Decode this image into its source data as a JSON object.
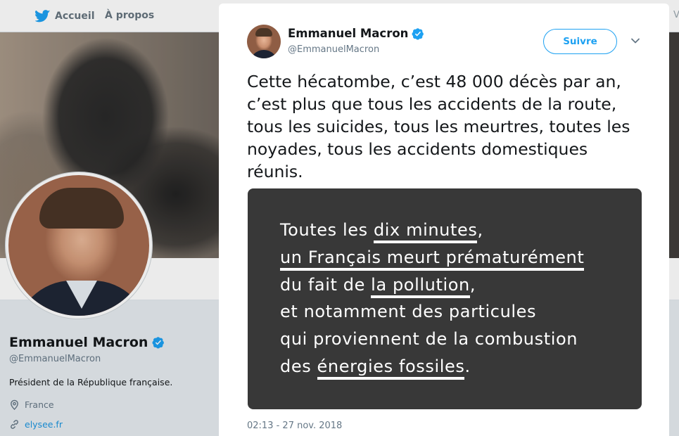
{
  "nav": {
    "home_label": "Accueil",
    "about_label": "À propos",
    "edge_char": "V"
  },
  "profile": {
    "name": "Emmanuel Macron",
    "handle": "@EmmanuelMacron",
    "bio": "Président de la République française.",
    "location": "France",
    "url": "elysee.fr"
  },
  "tweet": {
    "author_name": "Emmanuel Macron",
    "author_handle": "@EmmanuelMacron",
    "follow_label": "Suivre",
    "text": "Cette hécatombe, c’est 48 000 décès par an, c’est plus que tous les accidents de la route, tous les suicides, tous les meurtres, toutes les noyades, tous les accidents domestiques réunis.",
    "timestamp": "02:13 - 27 nov. 2018",
    "image_lines": [
      [
        {
          "t": "Toutes les "
        },
        {
          "t": "dix minutes",
          "u": true
        },
        {
          "t": ","
        }
      ],
      [
        {
          "t": "un Français meurt prématurément",
          "u": true
        }
      ],
      [
        {
          "t": "du fait de "
        },
        {
          "t": "la pollution",
          "u": true
        },
        {
          "t": ","
        }
      ],
      [
        {
          "t": "et notamment des particules"
        }
      ],
      [
        {
          "t": "qui proviennent de la combustion"
        }
      ],
      [
        {
          "t": "des "
        },
        {
          "t": "énergies fossiles",
          "u": true
        },
        {
          "t": "."
        }
      ]
    ]
  },
  "colors": {
    "accent": "#1da1f2",
    "verified": "#1da1f2",
    "image_background": "#383838"
  },
  "icons": [
    "twitter-bird-icon",
    "verified-badge-icon",
    "chevron-down-icon",
    "location-pin-icon",
    "link-icon"
  ]
}
